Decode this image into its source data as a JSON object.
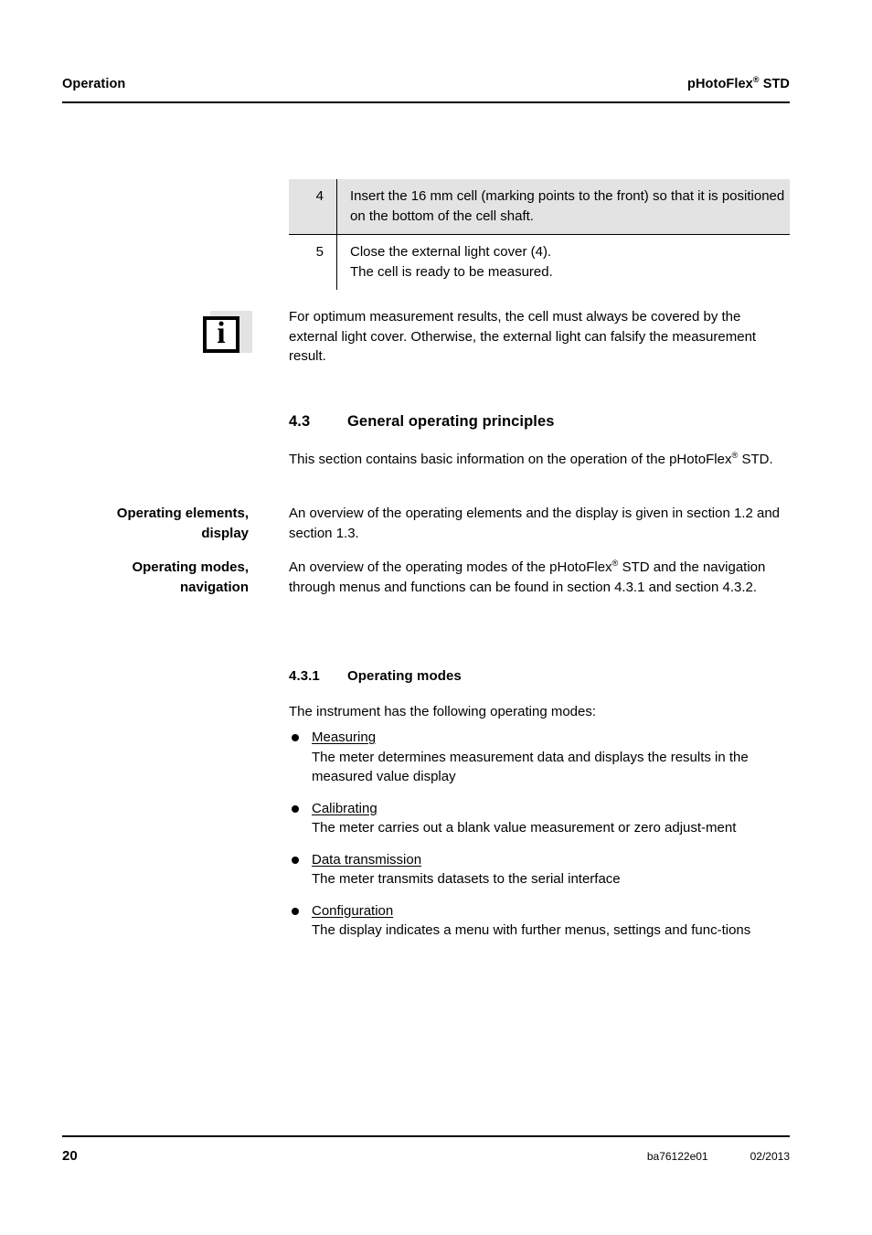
{
  "header": {
    "left": "Operation",
    "product_name": "pHotoFlex",
    "product_mark": "®",
    "product_suffix": " STD"
  },
  "step_table": {
    "rows": [
      {
        "number": "4",
        "text": "Insert the 16 mm cell (marking points to the front) so that it is positioned on the bottom of the cell shaft.",
        "shaded": true
      },
      {
        "number": "5",
        "line1": "Close the external light cover (4).",
        "line2": "The cell is ready to be measured.",
        "shaded": false
      }
    ]
  },
  "note": {
    "icon_glyph": "i",
    "icon_name": "information-icon",
    "text": "For optimum measurement results, the cell must always be covered by the external light cover. Otherwise, the external light can falsify the measurement result."
  },
  "section_43": {
    "number": "4.3",
    "title": "General operating principles",
    "intro_part1": "This section contains basic information on the operation of the pHotoFlex",
    "intro_mark": "®",
    "intro_part2": " STD."
  },
  "marginals": [
    {
      "label_line1": "Operating elements,",
      "label_line2": "display",
      "text": "An overview of the operating elements and the display is given in section 1.2 and section 1.3."
    },
    {
      "label_line1": "Operating modes,",
      "label_line2": "navigation",
      "text_part1": "An overview of the operating modes of the pHotoFlex",
      "text_mark": "®",
      "text_part2": " STD and the navigation through menus and functions can be found in section 4.3.1 and section 4.3.2."
    }
  ],
  "section_431": {
    "number": "4.3.1",
    "title": "Operating modes",
    "intro": "The instrument has the following operating modes:",
    "items": [
      {
        "title": "Measuring",
        "description": "The meter determines measurement data and displays the results in the measured value display"
      },
      {
        "title": "Calibrating",
        "description": "The meter carries out a blank value measurement or zero adjust-ment"
      },
      {
        "title": "Data transmission",
        "description": "The meter transmits datasets to the serial interface"
      },
      {
        "title": "Configuration",
        "description": "The display indicates a menu with further menus, settings and func-tions"
      }
    ]
  },
  "footer": {
    "page_number": "20",
    "document_number": "ba76122e01",
    "date": "02/2013"
  },
  "colors": {
    "shaded_row": "#e3e3e3",
    "rule": "#000000",
    "text": "#000000"
  }
}
